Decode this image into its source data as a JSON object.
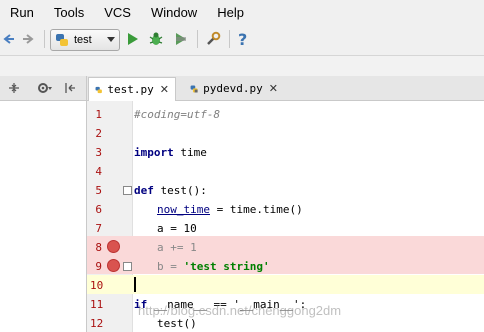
{
  "menubar": {
    "items": [
      "Run",
      "Tools",
      "VCS",
      "Window",
      "Help"
    ]
  },
  "toolbar": {
    "run_config": "test"
  },
  "tabs": [
    {
      "label": "test.py",
      "active": true
    },
    {
      "label": "pydevd.py",
      "active": false
    }
  ],
  "editor": {
    "lines": [
      {
        "num": "1",
        "text": "#coding=utf-8"
      },
      {
        "num": "2",
        "text": ""
      },
      {
        "num": "3",
        "kw": "import",
        "rest": " time"
      },
      {
        "num": "4",
        "text": ""
      },
      {
        "num": "5",
        "kw": "def",
        "rest": " test():"
      },
      {
        "num": "6",
        "ul": "now_time",
        "rest": " = time.time()"
      },
      {
        "num": "7",
        "text": "a = 10"
      },
      {
        "num": "8",
        "text": "a += 1"
      },
      {
        "num": "9",
        "pre": "b = ",
        "str": "'test string'"
      },
      {
        "num": "10",
        "text": ""
      },
      {
        "num": "11",
        "kw": "if",
        "rest": " __name__ == '__main__':"
      },
      {
        "num": "12",
        "text": "test()"
      }
    ]
  },
  "watermark": "http://blog.csdn.net/chenggong2dm",
  "colors": {
    "breakpoint_line": "#fad9d9",
    "current_line": "#ffffd7",
    "line_number": "#aa1111"
  },
  "icons": [
    "back-icon",
    "forward-icon",
    "python-icon",
    "run-icon",
    "debug-icon",
    "coverage-icon",
    "wrench-icon",
    "help-icon"
  ]
}
